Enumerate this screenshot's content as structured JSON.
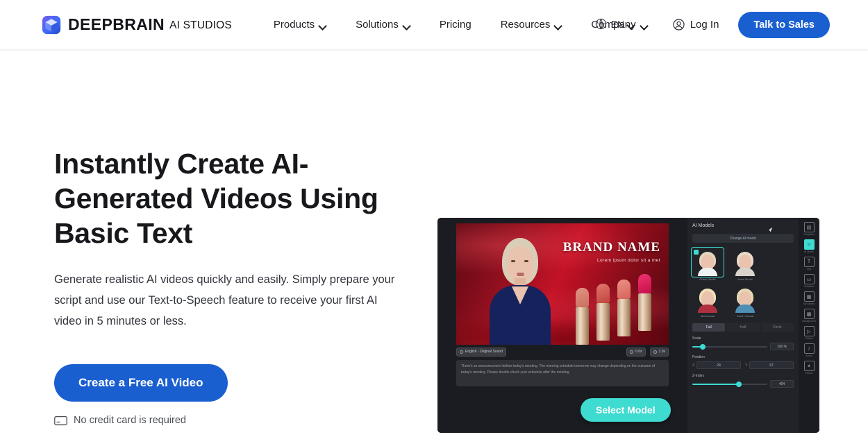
{
  "header": {
    "logo_icon": "cube-logo-icon",
    "brand_name": "DEEPBRAIN",
    "brand_sub": "AI STUDIOS",
    "nav": [
      {
        "label": "Products",
        "has_chevron": true
      },
      {
        "label": "Solutions",
        "has_chevron": true
      },
      {
        "label": "Pricing",
        "has_chevron": false
      },
      {
        "label": "Resources",
        "has_chevron": true
      },
      {
        "label": "Company",
        "has_chevron": true
      }
    ],
    "language": {
      "icon": "globe-icon",
      "label": "EN"
    },
    "login": {
      "icon": "user-circle-icon",
      "label": "Log In"
    },
    "cta": {
      "label": "Talk to Sales",
      "color": "#1a5fd0"
    }
  },
  "hero": {
    "title": "Instantly Create AI-Generated Videos Using Basic Text",
    "subtitle": "Generate realistic AI videos quickly and easily. Simply prepare your script and use our Text-to-Speech feature to receive your first AI video in 5 minutes or less.",
    "cta_label": "Create a Free AI Video",
    "note_icon": "credit-card-icon",
    "note": "No credit card is required"
  },
  "app_preview": {
    "canvas": {
      "brand_name": "BRAND NAME",
      "brand_tagline": "Lorem ipsum dolor sit a met"
    },
    "voice_chip": {
      "icon": "voice-icon",
      "label": "English - Original Sound"
    },
    "duration_chips": [
      {
        "icon": "clock-icon",
        "label": "0.0s"
      },
      {
        "icon": "clock-icon",
        "label": "1.0s"
      }
    ],
    "script_text": "There's an announcement before today's meeting. The morning schedule tomorrow may change depending on the outcome of today's meeting. Please double-check your schedule after the meeting.",
    "select_model_button": {
      "label": "Select Model",
      "color": "#3ddbd0"
    },
    "panel": {
      "title": "AI Models",
      "change_button": "Change AI model",
      "models": [
        {
          "name": "Grace Studio",
          "selected": true,
          "hair": "#e3d6bd",
          "body": "#f0f1f3"
        },
        {
          "name": "Anna Studio",
          "selected": false,
          "hair": "#e8dcc6",
          "body": "#d8d4cc"
        },
        {
          "name": "Mia Casual",
          "selected": false,
          "hair": "#f0e0b8",
          "body": "#b03040"
        },
        {
          "name": "Sarah Casual",
          "selected": false,
          "hair": "#e6d7b5",
          "body": "#4f8fb5"
        }
      ],
      "tabs": [
        {
          "label": "Full",
          "active": true
        },
        {
          "label": "Half",
          "active": false
        },
        {
          "label": "Circle",
          "active": false
        }
      ],
      "controls": [
        {
          "label": "Scale",
          "value": "100 %",
          "fill_pct": 14
        },
        {
          "label": "Z-Index",
          "value": "404",
          "fill_pct": 62
        }
      ],
      "position": {
        "label": "Position",
        "x_key": "X",
        "x_value": "24",
        "y_key": "Y",
        "y_value": "67"
      }
    },
    "toolbar": [
      {
        "icon": "template-icon",
        "label": "Templates",
        "active": false
      },
      {
        "icon": "ai-model-icon",
        "label": "AI Model",
        "active": true
      },
      {
        "icon": "text-icon",
        "label": "Text",
        "active": false
      },
      {
        "icon": "subtitle-icon",
        "label": "Subtitles",
        "active": false
      },
      {
        "icon": "image-icon",
        "label": "My Assets",
        "active": false
      },
      {
        "icon": "background-icon",
        "label": "Background",
        "active": false
      },
      {
        "icon": "video-icon",
        "label": "Videos",
        "active": false
      },
      {
        "icon": "audio-icon",
        "label": "Audio",
        "active": false
      },
      {
        "icon": "effects-icon",
        "label": "Effects",
        "active": false
      }
    ]
  }
}
